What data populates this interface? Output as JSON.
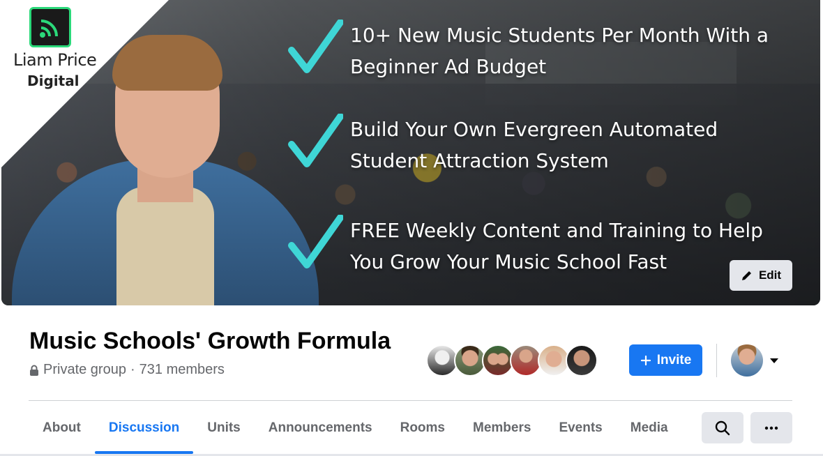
{
  "cover": {
    "logo": {
      "line1": "Liam Price",
      "line2": "Digital",
      "icon": "wifi-signal-icon",
      "icon_color": "#2bd97a"
    },
    "bullets": [
      {
        "line1": "10+ New Music Students Per Month With a",
        "line2": "Beginner Ad Budget"
      },
      {
        "line1": "Build Your Own Evergreen Automated",
        "line2": "Student Attraction System"
      },
      {
        "line1": "FREE Weekly Content and Training to Help",
        "line2": "You Grow Your Music School Fast"
      }
    ],
    "check_color": "#3fd6d6",
    "edit_label": "Edit",
    "edit_icon": "pencil-icon"
  },
  "group": {
    "title": "Music Schools' Growth Formula",
    "privacy": "Private group",
    "separator": "·",
    "members": "731 members",
    "privacy_icon": "lock-icon"
  },
  "member_avatars": [
    {
      "color": "#d9d9d9"
    },
    {
      "color": "#6b7a5a"
    },
    {
      "color": "#8a6a5a"
    },
    {
      "color": "#b05a5a"
    },
    {
      "color": "#c28a6a"
    },
    {
      "color": "#3a3a3a"
    }
  ],
  "actions": {
    "invite_label": "Invite",
    "invite_icon": "plus-icon",
    "accent": "#1877f2"
  },
  "tabs": [
    {
      "label": "About",
      "active": false
    },
    {
      "label": "Discussion",
      "active": true
    },
    {
      "label": "Units",
      "active": false
    },
    {
      "label": "Announcements",
      "active": false
    },
    {
      "label": "Rooms",
      "active": false
    },
    {
      "label": "Members",
      "active": false
    },
    {
      "label": "Events",
      "active": false
    },
    {
      "label": "Media",
      "active": false
    }
  ],
  "tools": {
    "search_icon": "search-icon",
    "more_icon": "more-icon"
  }
}
